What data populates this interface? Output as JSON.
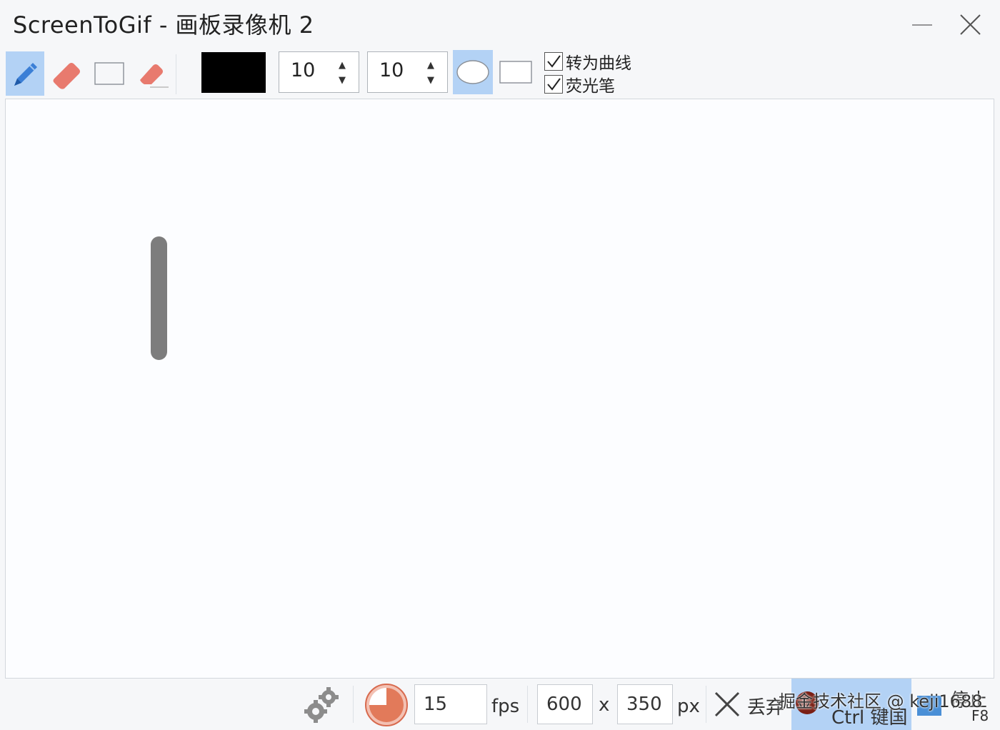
{
  "window": {
    "title": "ScreenToGif - 画板录像机 2"
  },
  "toolbar": {
    "tools": [
      {
        "name": "pen",
        "icon": "pencil-icon",
        "active": true
      },
      {
        "name": "eraser",
        "icon": "eraser-icon",
        "active": false
      },
      {
        "name": "select",
        "icon": "rectangle-select-icon",
        "active": false
      },
      {
        "name": "stroke-eraser",
        "icon": "stroke-eraser-icon",
        "active": false
      }
    ],
    "color": "#000000",
    "width_value": "10",
    "height_value": "10",
    "tip_shapes": [
      {
        "name": "ellipse",
        "icon": "ellipse-tip-icon",
        "active": true
      },
      {
        "name": "rectangle",
        "icon": "rectangle-tip-icon",
        "active": false
      }
    ],
    "checkboxes": [
      {
        "label": "转为曲线",
        "checked": true
      },
      {
        "label": "荧光笔",
        "checked": true
      }
    ]
  },
  "status": {
    "fps_value": "15",
    "fps_unit": "fps",
    "width_value": "600",
    "times": "x",
    "height_value": "350",
    "px_unit": "px",
    "discard_label": "丢弃",
    "record_label": "Ctrl 键国",
    "stop_hint": "F8",
    "stop_label_tail": "停止"
  },
  "watermark": "掘金技术社区 @ keji1688",
  "colors": {
    "accent_active": "#b3d2f5",
    "eraser": "#e87a6e",
    "pen": "#3b7fd6",
    "stroke": "#7d7d7d",
    "record": "#7a1f14"
  }
}
